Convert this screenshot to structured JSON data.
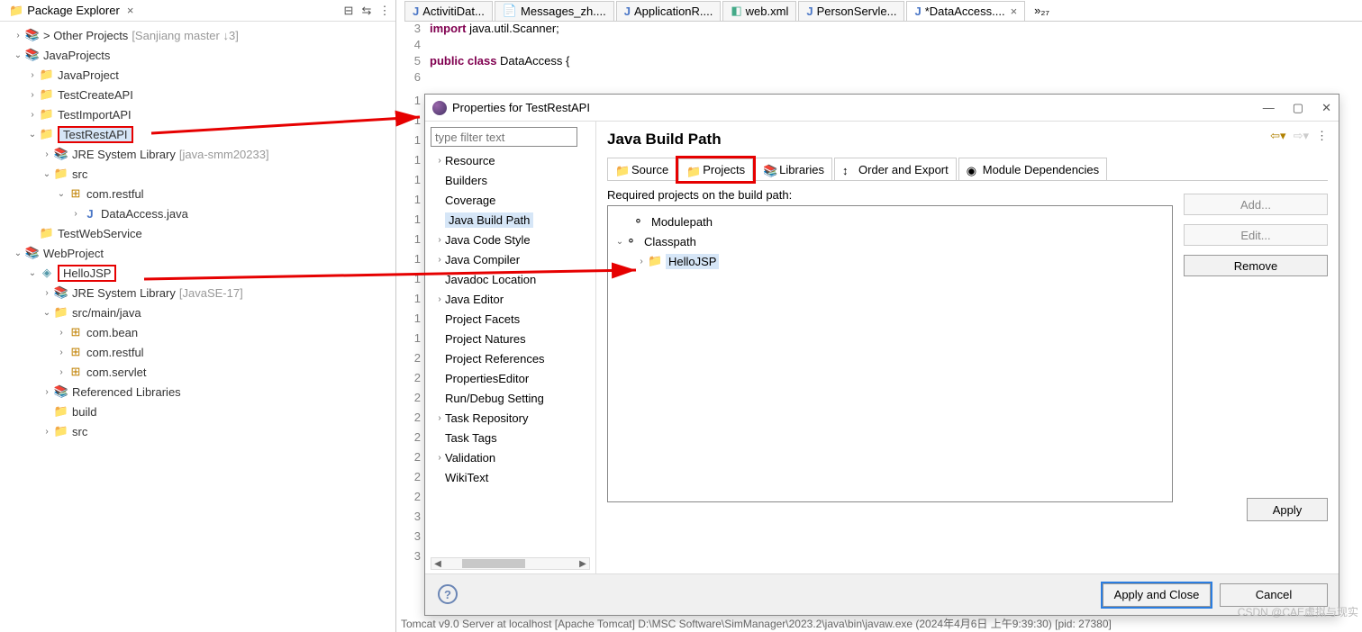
{
  "explorer": {
    "title": "Package Explorer",
    "other_projects": "Other Projects",
    "other_projects_suffix": "[Sanjiang master ↓3]",
    "ws1": "JavaProjects",
    "p_javaproject": "JavaProject",
    "p_testcreate": "TestCreateAPI",
    "p_testimport": "TestImportAPI",
    "p_testrest": "TestRestAPI",
    "jre_lib": "JRE System Library",
    "jre_suffix1": "[java-smm20233]",
    "src": "src",
    "pkg_restful": "com.restful",
    "file_da": "DataAccess.java",
    "p_testweb": "TestWebService",
    "ws2": "WebProject",
    "p_hellojsp": "HelloJSP",
    "jre_suffix2": "[JavaSE-17]",
    "src_main": "src/main/java",
    "pkg_bean": "com.bean",
    "pkg_restful2": "com.restful",
    "pkg_servlet": "com.servlet",
    "ref_lib": "Referenced Libraries",
    "build": "build",
    "src2": "src"
  },
  "editor_tabs": {
    "t1": "ActivitiDat...",
    "t2": "Messages_zh....",
    "t3": "ApplicationR....",
    "t4": "web.xml",
    "t5": "PersonServle...",
    "t6": "*DataAccess....",
    "overflow": "»₂₇"
  },
  "code": {
    "l3a": "import",
    "l3b": " java.util.Scanner;",
    "l5a": "public class",
    "l5b": " DataAccess {",
    "g3": "3",
    "g4": "4",
    "g5": "5",
    "g6": "6"
  },
  "line_numbers": [
    "1",
    "1",
    "1",
    "1",
    "1",
    "1",
    "1",
    "1",
    "1",
    "1",
    "1",
    "1",
    "1",
    "2",
    "2",
    "2",
    "2",
    "2",
    "2",
    "2",
    "2",
    "3",
    "3",
    "3"
  ],
  "dialog": {
    "title": "Properties for TestRestAPI",
    "filter_placeholder": "type filter text",
    "categories": {
      "resource": "Resource",
      "builders": "Builders",
      "coverage": "Coverage",
      "jbp": "Java Build Path",
      "jcs": "Java Code Style",
      "jc": "Java Compiler",
      "jl": "Javadoc Location",
      "je": "Java Editor",
      "pf": "Project Facets",
      "pn": "Project Natures",
      "pr": "Project References",
      "pe": "PropertiesEditor",
      "rds": "Run/Debug Setting",
      "tr": "Task Repository",
      "tt": "Task Tags",
      "val": "Validation",
      "wt": "WikiText"
    },
    "heading": "Java Build Path",
    "tabs": {
      "source": "Source",
      "projects": "Projects",
      "libraries": "Libraries",
      "order": "Order and Export",
      "module": "Module Dependencies"
    },
    "required_label": "Required projects on the build path:",
    "modulepath": "Modulepath",
    "classpath": "Classpath",
    "hellojsp": "HelloJSP",
    "btn_add": "Add...",
    "btn_edit": "Edit...",
    "btn_remove": "Remove",
    "btn_apply": "Apply",
    "btn_apply_close": "Apply and Close",
    "btn_cancel": "Cancel"
  },
  "status": "Tomcat v9.0 Server at localhost [Apache Tomcat] D:\\MSC Software\\SimManager\\2023.2\\java\\bin\\javaw.exe (2024年4月6日 上午9:39:30) [pid: 27380]",
  "watermark": "CSDN @CAE虚拟与现实"
}
